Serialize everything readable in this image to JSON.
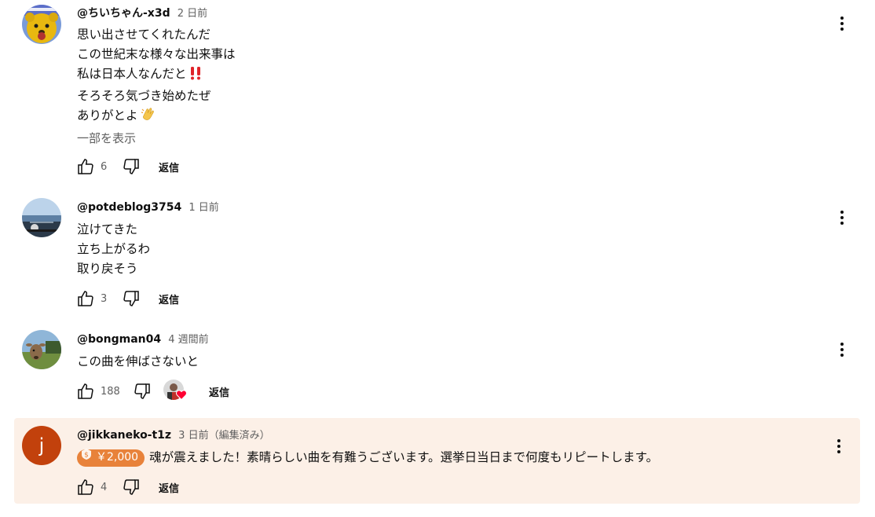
{
  "comments": [
    {
      "author": "@ちいちゃん-x3d",
      "time": "2 日前",
      "lines": [
        "思い出させてくれたんだ",
        "この世紀末な様々な出来事は",
        "私は日本人なんだと",
        "そろそろ気づき始めたぜ",
        "ありがとよ"
      ],
      "show_more": "一部を表示",
      "likes": "6",
      "reply": "返信",
      "avatar_icon": "pooh-bear-avatar"
    },
    {
      "author": "@potdeblog3754",
      "time": "1 日前",
      "lines": [
        "泣けてきた",
        "立ち上がるわ",
        "取り戻そう"
      ],
      "likes": "3",
      "reply": "返信",
      "avatar_icon": "sea-landscape-avatar"
    },
    {
      "author": "@bongman04",
      "time": "4 週間前",
      "lines": [
        "この曲を伸ばさないと"
      ],
      "likes": "188",
      "reply": "返信",
      "avatar_icon": "deer-avatar",
      "creator_heart": true
    },
    {
      "author": "@jikkaneko-t1z",
      "time": "3 日前（編集済み）",
      "superchat_amount": "￥2,000",
      "text": "魂が震えました！素晴らしい曲を有難うございます。選挙日当日まで何度もリピートします。",
      "likes": "4",
      "reply": "返信",
      "avatar_letter": "j",
      "avatar_color": "#c2410c",
      "highlight_color": "#fcf0e7",
      "superchat_color": "#e8823a"
    }
  ]
}
